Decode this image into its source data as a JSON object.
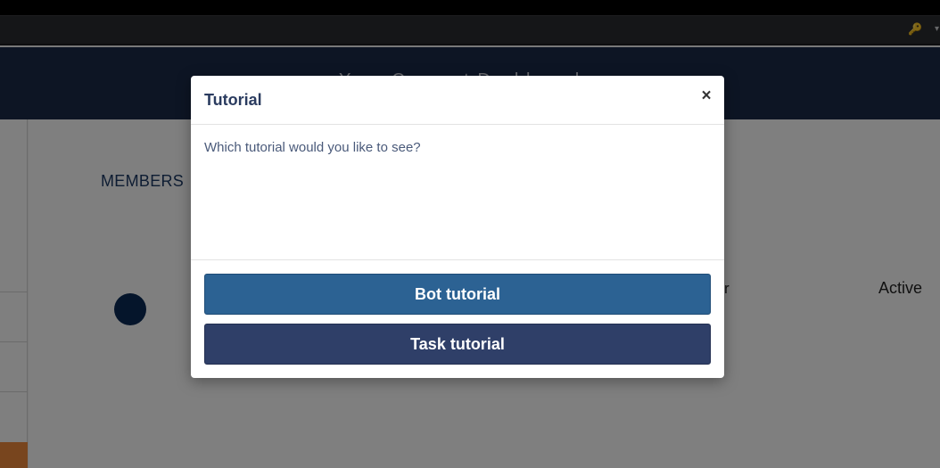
{
  "header": {
    "title": "Yoco Connect Dashboard"
  },
  "page": {
    "members_heading": "MEMBERS",
    "member_role_partial": "r",
    "member_status": "Active"
  },
  "modal": {
    "title": "Tutorial",
    "close_label": "×",
    "prompt": "Which tutorial would you like to see?",
    "buttons": {
      "bot": "Bot tutorial",
      "task": "Task tutorial"
    }
  },
  "icons": {
    "key": "key-icon",
    "dropdown": "chevron-down-icon"
  },
  "colors": {
    "header_bg": "#1a2a49",
    "bot_button": "#2c6293",
    "task_button": "#2f3f68",
    "accent_orange": "#f08a3c"
  }
}
